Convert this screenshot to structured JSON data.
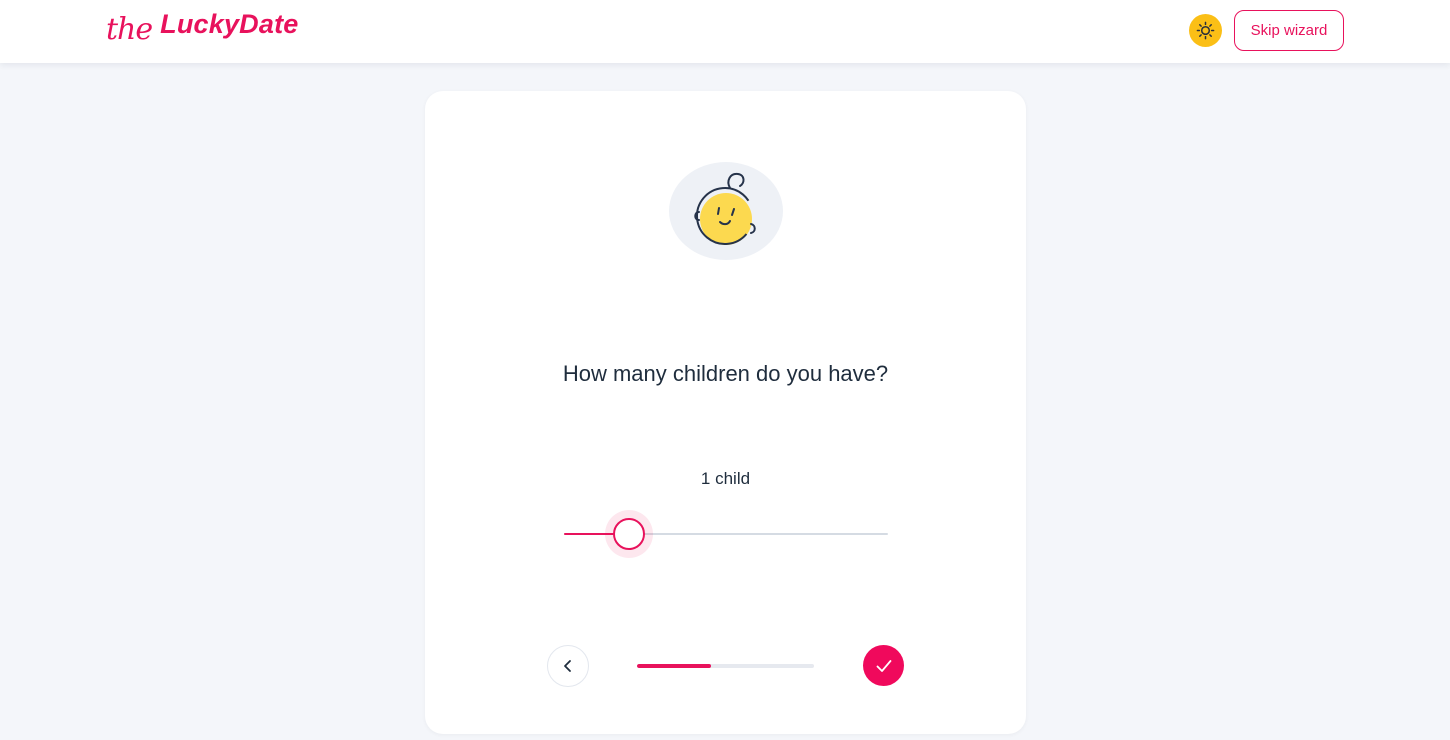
{
  "header": {
    "logo_prefix": "the",
    "logo_brand": "LuckyDate",
    "theme_toggle_icon": "sun-icon",
    "skip_label": "Skip wizard"
  },
  "wizard": {
    "illustration_icon": "baby-face-icon",
    "question": "How many children do you have?",
    "value_label": "1 child",
    "slider": {
      "value": 1,
      "min": 0,
      "max": 5
    },
    "progress_fraction": 0.42,
    "back_icon": "chevron-left-icon",
    "next_icon": "checkmark-icon"
  },
  "colors": {
    "accent": "#e8125c",
    "theme_toggle": "#fbbf16",
    "background": "#f4f6fa"
  }
}
